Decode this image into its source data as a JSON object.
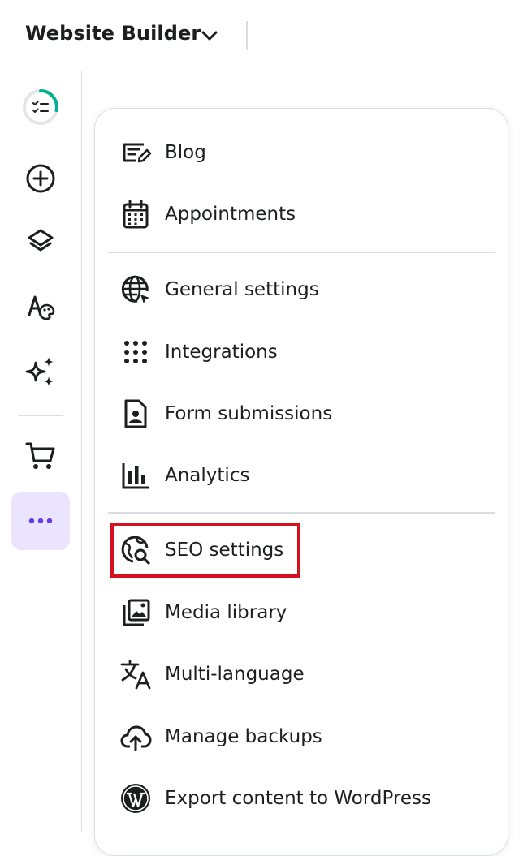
{
  "header": {
    "title": "Website Builder",
    "title_chevron_icon": "chevron-down-icon"
  },
  "sidebar": {
    "items": [
      {
        "name": "progress-checklist",
        "icon": "checklist-progress-icon"
      },
      {
        "name": "add-element",
        "icon": "plus-circle-icon"
      },
      {
        "name": "layers",
        "icon": "layers-icon"
      },
      {
        "name": "styles",
        "icon": "font-palette-icon"
      },
      {
        "name": "ai-tools",
        "icon": "sparkles-icon"
      },
      {
        "name": "store",
        "icon": "cart-icon"
      },
      {
        "name": "more",
        "icon": "more-dots-icon",
        "active": true
      }
    ],
    "progress_color": "#00b090"
  },
  "menu": {
    "sections": [
      {
        "items": [
          {
            "label": "Blog",
            "icon": "blog-edit-icon"
          },
          {
            "label": "Appointments",
            "icon": "calendar-icon"
          }
        ]
      },
      {
        "items": [
          {
            "label": "General settings",
            "icon": "globe-cursor-icon"
          },
          {
            "label": "Integrations",
            "icon": "grid-dots-icon"
          },
          {
            "label": "Form submissions",
            "icon": "form-user-icon"
          },
          {
            "label": "Analytics",
            "icon": "bar-chart-icon"
          }
        ]
      },
      {
        "items": [
          {
            "label": "SEO settings",
            "icon": "globe-search-icon",
            "highlighted": true
          },
          {
            "label": "Media library",
            "icon": "media-library-icon"
          },
          {
            "label": "Multi-language",
            "icon": "translate-icon"
          },
          {
            "label": "Manage backups",
            "icon": "cloud-upload-icon"
          },
          {
            "label": "Export content to WordPress",
            "icon": "wordpress-icon"
          }
        ]
      }
    ]
  },
  "colors": {
    "text": "#1d1e20",
    "border": "#dcdce4",
    "active_bg": "#ebe4ff",
    "accent": "#673de6",
    "highlight": "#d4121f"
  }
}
